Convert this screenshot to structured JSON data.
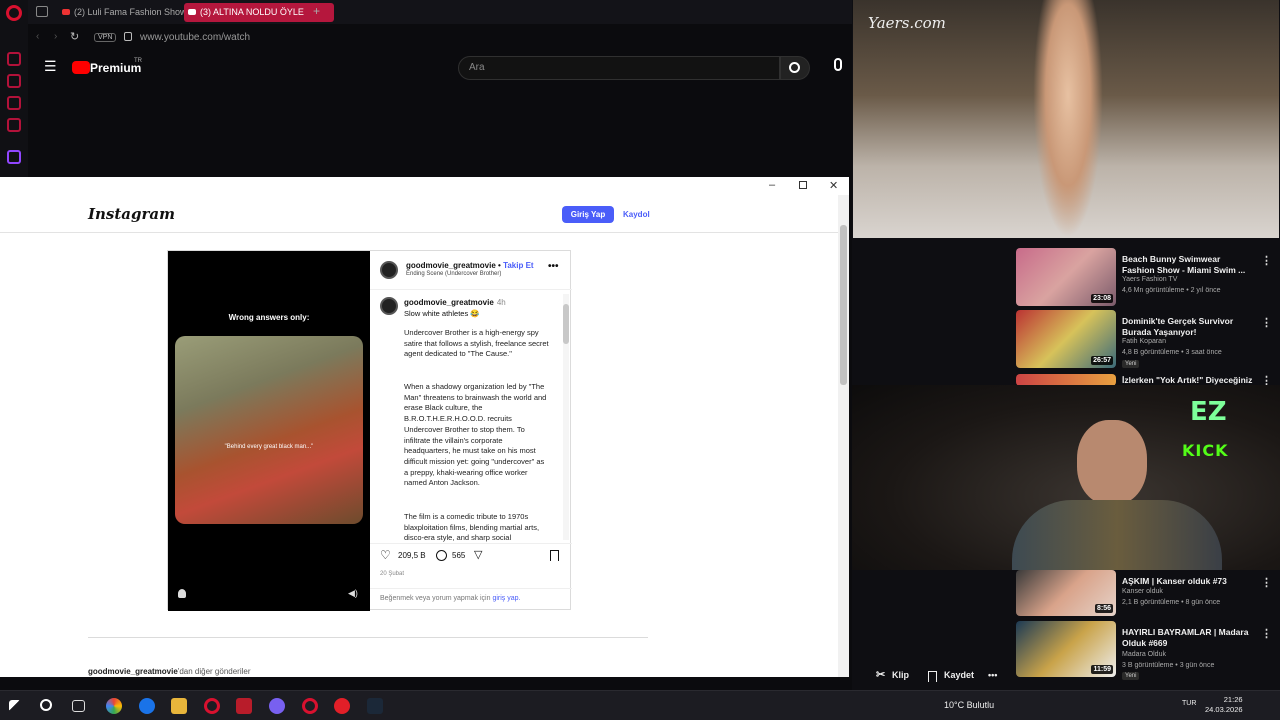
{
  "browser": {
    "tabs": [
      {
        "label": "(2) Luli Fama Fashion Show"
      },
      {
        "label": "(3) ALTINA NOLDU ÖYLE"
      }
    ],
    "add_tab": "+",
    "vpn": "VPN",
    "url": "www.youtube.com/watch"
  },
  "youtube": {
    "brand": "Premium",
    "brand_sup": "TR",
    "search_placeholder": "Ara"
  },
  "instagram": {
    "logo": "Instagram",
    "login_label": "Giriş Yap",
    "signup_label": "Kaydol",
    "video_caption": "Wrong answers only:",
    "video_subtitle": "\"Behind every great black man...\"",
    "author": "goodmovie_greatmovie",
    "follow_label": "Takip Et",
    "audio": "Ending Scene (Undercover Brother)",
    "cap_author": "goodmovie_greatmovie",
    "cap_time": "4h",
    "cap_first": "Slow white athletes 😂",
    "cap_paragraphs": [
      "Undercover Brother is a high-energy spy satire that follows a stylish, freelance secret agent dedicated to \"The Cause.\"",
      "When a shadowy organization led by \"The Man\" threatens to brainwash the world and erase Black culture, the B.R.O.T.H.E.R.H.O.O.D. recruits Undercover Brother to stop them. To infiltrate the villain's corporate headquarters, he must take on his most difficult mission yet: going \"undercover\" as a preppy, khaki-wearing office worker named Anton Jackson.",
      "The film is a comedic tribute to 1970s blaxploitation films, blending martial arts, disco-era style, and sharp social"
    ],
    "likes": "209,5 B",
    "comments": "565",
    "date": "20 Şubat",
    "comment_prompt_pre": "Beğenmek veya yorum yapmak için ",
    "comment_prompt_link": "giriş yap.",
    "more_author": "goodmovie_greatmovie",
    "more_rest": "'dan diğer gönderiler"
  },
  "stream": {
    "runway_watermark": "Yaers.com",
    "ez_logo": "EZ",
    "kick_logo": "KICK",
    "videos": [
      {
        "title": "Beach Bunny Swimwear Fashion Show - Miami Swim ...",
        "channel": "Yaers Fashion TV",
        "meta": "4,6 Mn görüntüleme • 2 yıl önce",
        "duration": "23:08",
        "new": ""
      },
      {
        "title": "Dominik'te Gerçek Survivor Burada Yaşanıyor!",
        "channel": "Fatih Koparan",
        "meta": "4,8 B görüntüleme • 3 saat önce",
        "duration": "26:57",
        "new": "Yeni"
      },
      {
        "title": "İzlerken \"Yok Artık!\" Diyeceğiniz",
        "channel": "",
        "meta": "",
        "duration": "",
        "new": ""
      },
      {
        "title": "AŞKIM | Kanser olduk #73",
        "channel": "Kanser olduk",
        "meta": "2,1 B görüntüleme • 8 gün önce",
        "duration": "8:56",
        "new": ""
      },
      {
        "title": "HAYIRLI BAYRAMLAR | Madara Olduk #669",
        "channel": "Madara Olduk",
        "meta": "3 B görüntüleme • 3 gün önce",
        "duration": "11:59",
        "new": "Yeni"
      }
    ],
    "actions": {
      "clip": "Klip",
      "save": "Kaydet",
      "more": "•••"
    }
  },
  "taskbar": {
    "weather": "10°C  Bulutlu",
    "lang": "TUR",
    "time": "21:26",
    "date": "24.03.2026"
  },
  "colors": {
    "accent": "#4a5df9",
    "yt_red": "#ff0000",
    "opera_red": "#d8112f"
  }
}
